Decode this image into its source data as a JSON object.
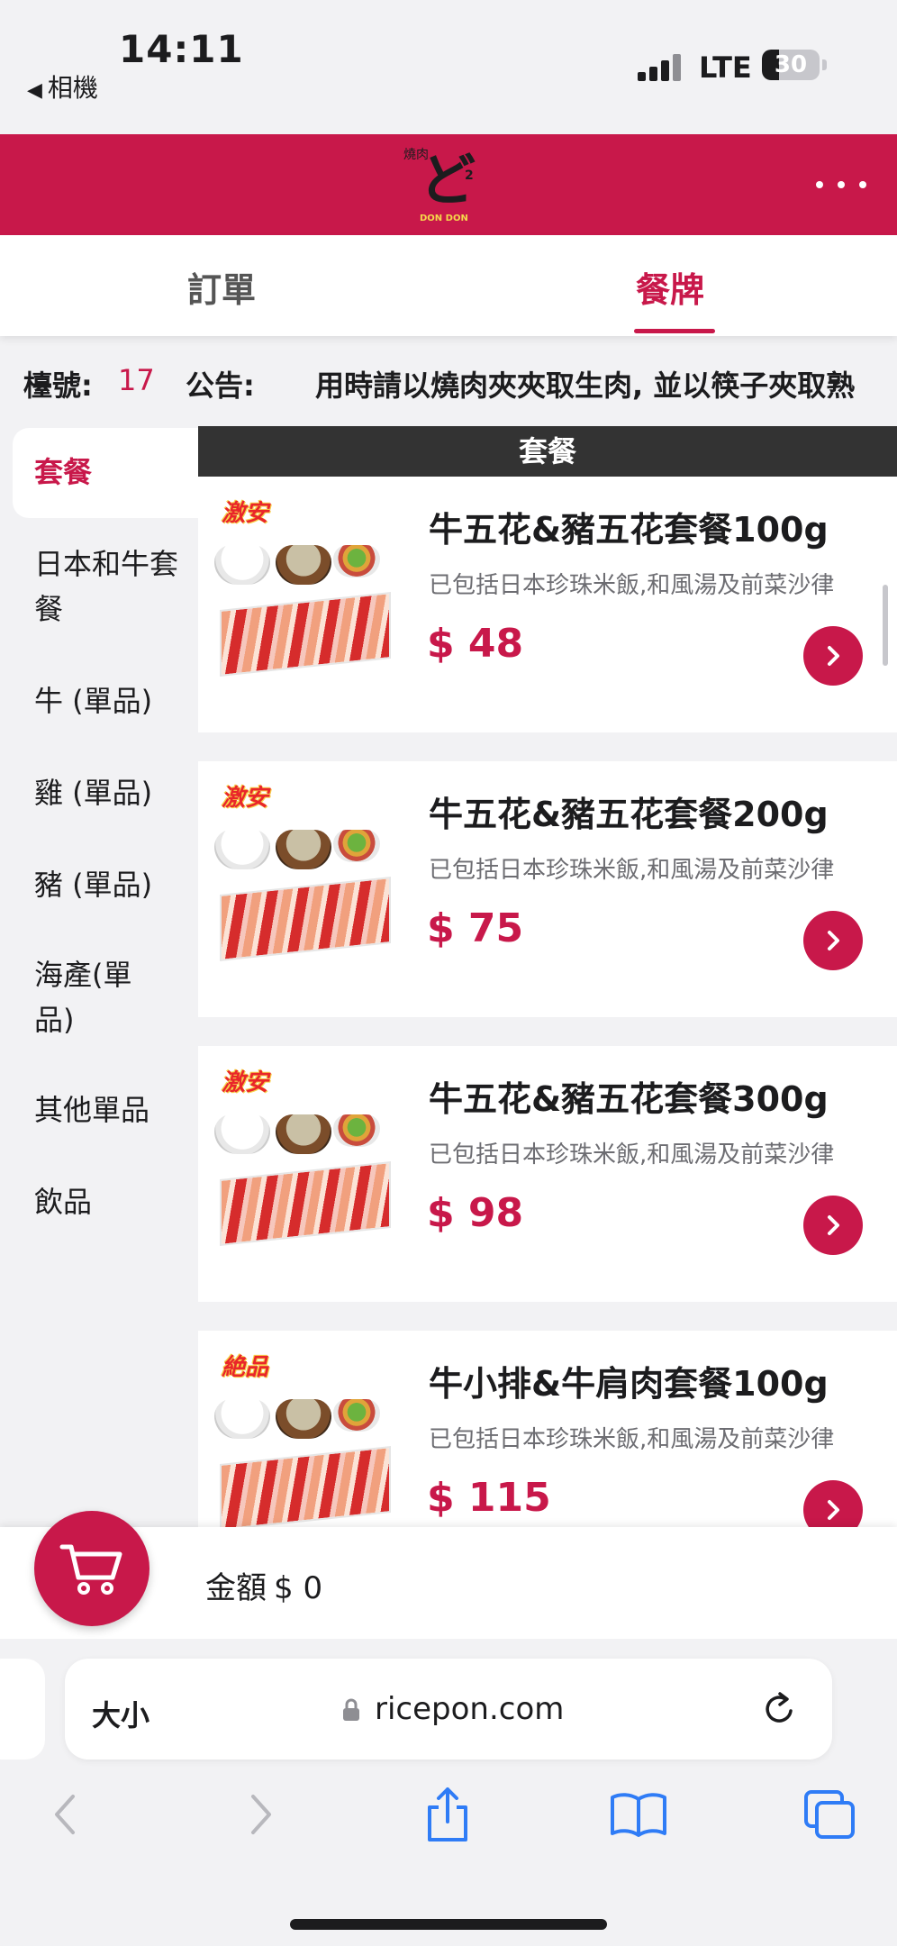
{
  "status_bar": {
    "time": "14:11",
    "back_label": "相機",
    "network": "LTE",
    "battery": "30",
    "battery_level": 0.3
  },
  "header": {
    "logo_top": "燒肉",
    "logo_main": "ど",
    "logo_sup": "2",
    "logo_sub": "DON DON",
    "brand_color": "#c8184a"
  },
  "tabs": [
    {
      "label": "訂單",
      "active": false
    },
    {
      "label": "餐牌",
      "active": true
    }
  ],
  "info": {
    "table_label": "檯號:",
    "table_number": "17",
    "notice_label": "公告:",
    "notice_text": "用時請以燒肉夾夾取生肉, 並以筷子夾取熟"
  },
  "sidebar": {
    "categories": [
      {
        "label": "套餐",
        "active": true
      },
      {
        "label": "日本和牛套餐",
        "active": false
      },
      {
        "label": "牛 (單品)",
        "active": false
      },
      {
        "label": "雞 (單品)",
        "active": false
      },
      {
        "label": "豬 (單品)",
        "active": false
      },
      {
        "label": "海產(單品)",
        "active": false
      },
      {
        "label": "其他單品",
        "active": false
      },
      {
        "label": "飲品",
        "active": false
      }
    ]
  },
  "menu": {
    "section_title": "套餐",
    "items": [
      {
        "badge": "激安",
        "name": "牛五花&豬五花套餐100g",
        "desc": "已包括日本珍珠米飯,和風湯及前菜沙律",
        "price": "$ 48"
      },
      {
        "badge": "激安",
        "name": "牛五花&豬五花套餐200g",
        "desc": "已包括日本珍珠米飯,和風湯及前菜沙律",
        "price": "$ 75"
      },
      {
        "badge": "激安",
        "name": "牛五花&豬五花套餐300g",
        "desc": "已包括日本珍珠米飯,和風湯及前菜沙律",
        "price": "$ 98"
      },
      {
        "badge": "絶品",
        "name": "牛小排&牛肩肉套餐100g",
        "desc": "已包括日本珍珠米飯,和風湯及前菜沙律",
        "price": "$ 115"
      }
    ]
  },
  "cart": {
    "amount_label": "金額",
    "amount": "$ 0"
  },
  "browser": {
    "text_size": "大小",
    "url": "ricepon.com",
    "icons": [
      "back-arrow-icon",
      "forward-arrow-icon",
      "share-icon",
      "bookmarks-icon",
      "tabs-icon"
    ]
  }
}
